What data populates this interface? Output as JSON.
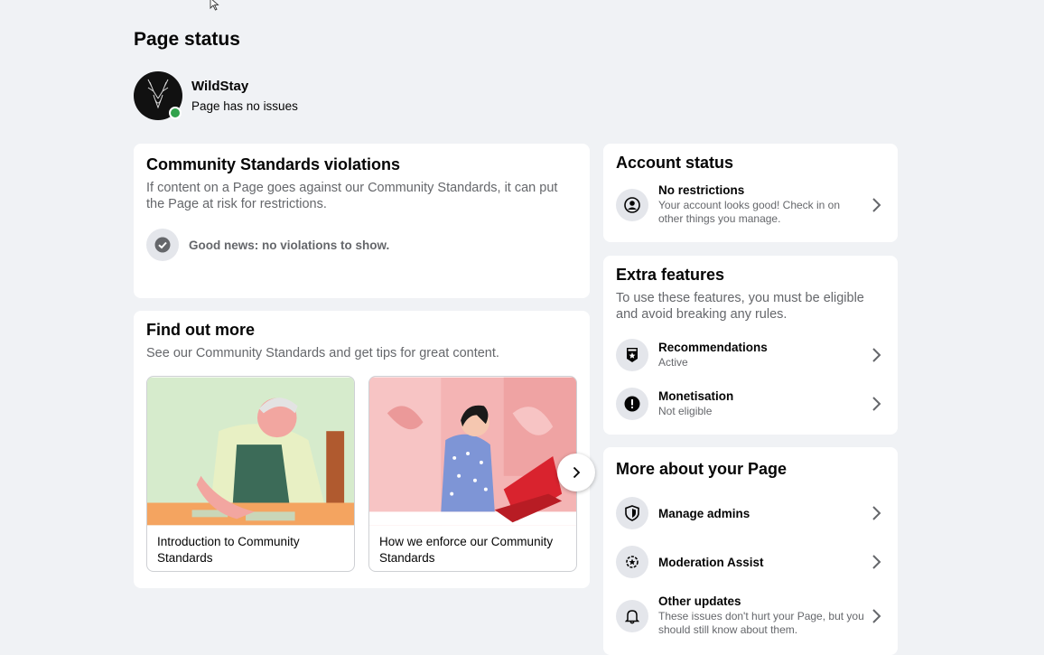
{
  "page": {
    "title": "Page status",
    "name": "WildStay",
    "status": "Page has no issues"
  },
  "violations": {
    "title": "Community Standards violations",
    "description": "If content on a Page goes against our Community Standards, it can put the Page at risk for restrictions.",
    "good_news": "Good news: no violations to show."
  },
  "find_out": {
    "title": "Find out more",
    "description": "See our Community Standards and get tips for great content.",
    "tiles": [
      {
        "caption": "Introduction to Community Standards"
      },
      {
        "caption": "How we enforce our Community Standards"
      }
    ]
  },
  "account": {
    "title": "Account status",
    "item": {
      "title": "No restrictions",
      "subtitle": "Your account looks good! Check in on other things you manage."
    }
  },
  "extra": {
    "title": "Extra features",
    "description": "To use these features, you must be eligible and avoid breaking any rules.",
    "items": [
      {
        "title": "Recommendations",
        "subtitle": "Active"
      },
      {
        "title": "Monetisation",
        "subtitle": "Not eligible"
      }
    ]
  },
  "more": {
    "title": "More about your Page",
    "items": [
      {
        "title": "Manage admins"
      },
      {
        "title": "Moderation Assist"
      },
      {
        "title": "Other updates",
        "subtitle": "These issues don't hurt your Page, but you should still know about them."
      }
    ]
  },
  "icons": {
    "cursor": "mouse-pointer-icon",
    "check": "check-circle-icon",
    "person": "person-circle-icon",
    "recommend": "recommendation-badge-icon",
    "alert": "exclamation-icon",
    "shield": "shield-icon",
    "moderation": "gear-star-icon",
    "bell": "bell-icon",
    "chevron": "chevron-right-icon"
  },
  "colors": {
    "background": "#f0f2f5",
    "card": "#ffffff",
    "online": "#31a24c",
    "secondary_text": "#65676b"
  }
}
